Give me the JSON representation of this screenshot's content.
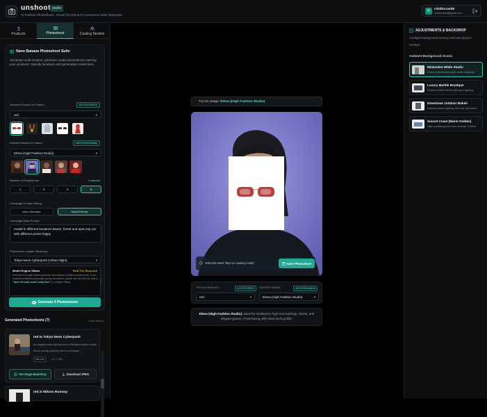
{
  "app": {
    "brand": "unshoot",
    "tag": "studio",
    "subtitle": "AI Fashion Photoshoots, Virtual Try-Ons & E-Commerce Asset Generator"
  },
  "user": {
    "initial": "R",
    "name": "rohithcrash9",
    "email": "rohithcrash9@gmail.com"
  },
  "tabs": [
    {
      "label": "Products"
    },
    {
      "label": "Photoshoot"
    },
    {
      "label": "Casting Models"
    }
  ],
  "suite": {
    "title": "Nano Banana Photoshoot Suite",
    "description": "Generate multi-location, premium model photoshoots starring your products. Specify locations and generation model tiers.",
    "product_label": "Selected Product to Feature",
    "product_pill": "ACCESSORIES",
    "product_value": "red",
    "model_label": "Selected Model to Feature",
    "model_pill": "MEDITERRANEAN",
    "model_value": "Elena (High Fashion Studio)",
    "variants_label": "Number of Photoshoots",
    "variants_pill": "4 variants",
    "variants": [
      "1",
      "2",
      "3",
      "4"
    ],
    "prompt_setting_label": "Campaign Prompt Setting",
    "auto_generate": "Auto-Generate",
    "meta_prompt": "Meta-Prompt",
    "meta_prompt_label": "Campaign Meta-Prompt",
    "meta_prompt_text": "model in different locations beach, forest and open top car with different poses happy",
    "location_label": "Photoshoot Location Backdrop",
    "location_value": "Tokyo Neon Cyberpunk (Urban Night)",
    "engine_label": "AI Model Engine",
    "engine_pill": "PAID TIER",
    "engine_value": "Gemini 3.1 Flash Lite (Fast, High Quality)",
    "status_title": "Model Engine Status",
    "status_flag": "Paid Tier Required",
    "status_text_1": "Paid Gemini image models generate ultra-realistic AI fashion photoshoots. If you experience fallback composite (proxy) simulations, please ask the AI in the chat to",
    "status_link": "\"Open the paid model setup flow\"",
    "status_text_2": "to configure billing.",
    "generate_button": "Generate 4 Photoshoots"
  },
  "generated": {
    "title": "Generated Photoshoots (7)",
    "clear": "Clear History",
    "items": [
      {
        "title": "red in Tokyo Neon Cyberpunk",
        "description": "An elegant wide editorial shot of Mediterranean model Elena posing playfully next to a vintage...",
        "badge": "Gen sim",
        "size": "4:5 • 1 MB",
        "stage_button": "Set Stage Backdrop",
        "download_button": "Download JPEG"
      },
      {
        "title": "red in Milano Runway"
      }
    ]
  },
  "stage": {
    "label": "Try-On Stage:",
    "model": "Elena (High Fashion Studio)",
    "footer_text": "Selected asset fitted on casting model",
    "save_button": "Save Photoshoot",
    "tryon_product_label": "TRY-ON PRODUCT",
    "tryon_product_pill": "ACCESSORIES",
    "tryon_product_value": "red",
    "casting_model_label": "CASTING MODEL",
    "casting_model_pill": "MEDITERRANEAN",
    "casting_model_value": "Elena (High Fashion Studio)",
    "info_name": "Elena (High Fashion Studio):",
    "info_text": "Ideal for necklaces, high-end earrings, Saree, and elegant gowns. Front-facing with clear neck profile."
  },
  "adjustments": {
    "title": "ADJUSTMENTS & BACKDROP",
    "description": "Configure background scenery and tune physics overlays",
    "section": "Ambient Background Scenic",
    "scenes": [
      {
        "name": "Minimalist White Studio",
        "desc": "Clean, professional white studio backdrop"
      },
      {
        "name": "Luxury Marble Boutique",
        "desc": "Premium retail interior with warm lighting"
      },
      {
        "name": "Downtown Outdoor Bokeh",
        "desc": "Natural outdoor lighting with soft, city bokeh"
      },
      {
        "name": "Sunset Coast (Warm Golden)",
        "desc": "High-contrast golden hour seaside. Perfect"
      }
    ]
  },
  "colors": {
    "accent": "#2ec9b1",
    "panel": "#121518",
    "stage_bg": "#7c7bc4"
  }
}
